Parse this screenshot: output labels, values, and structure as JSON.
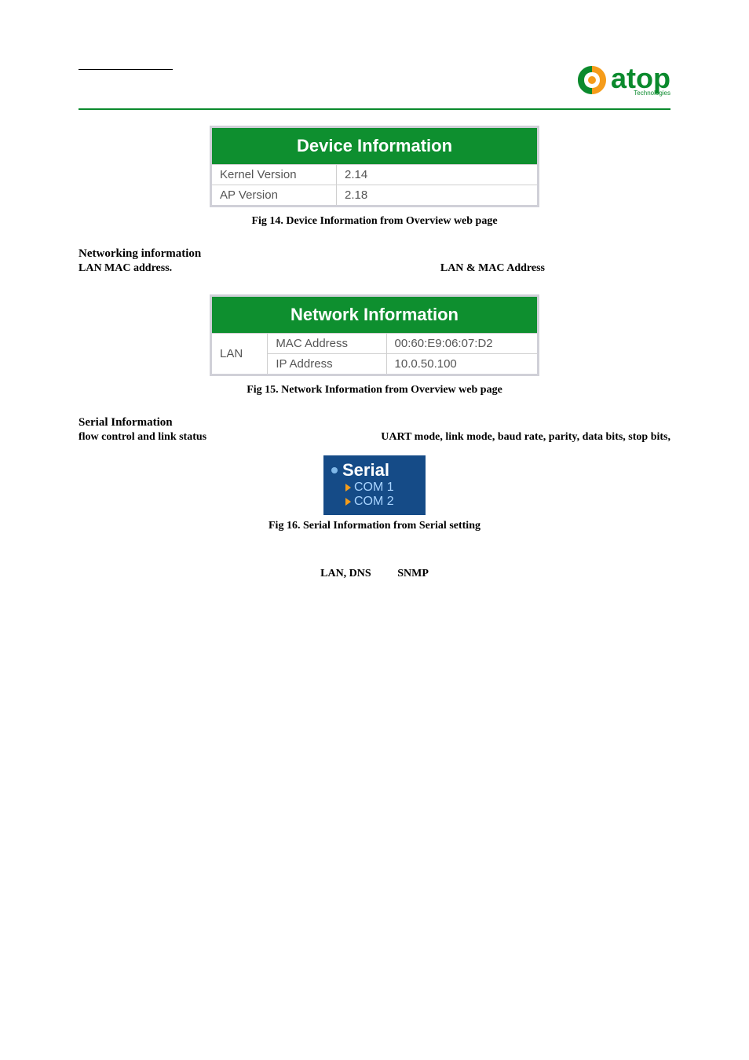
{
  "logo": {
    "text": "atop",
    "sub": "Technologies"
  },
  "device_info": {
    "header": "Device Information",
    "rows": [
      {
        "label": "Kernel Version",
        "value": "2.14"
      },
      {
        "label": "AP Version",
        "value": "2.18"
      }
    ],
    "caption": "Fig 14. Device Information from Overview web page"
  },
  "networking": {
    "heading": "Networking information",
    "right_label": "LAN  &  MAC  Address",
    "sub": "LAN MAC address."
  },
  "network_info": {
    "header": "Network Information",
    "group": "LAN",
    "rows": [
      {
        "label": "MAC Address",
        "value": "00:60:E9:06:07:D2"
      },
      {
        "label": "IP Address",
        "value": "10.0.50.100"
      }
    ],
    "caption": "Fig 15. Network Information from Overview web page"
  },
  "serial": {
    "heading": "Serial Information",
    "right_label": "UART mode, link mode, baud rate, parity, data bits, stop bits,",
    "sub": "flow control and link status",
    "box_title": "Serial",
    "items": [
      "COM 1",
      "COM 2"
    ],
    "caption": "Fig 16. Serial Information from Serial setting"
  },
  "bottom": {
    "a": "LAN, DNS",
    "b": "SNMP"
  }
}
